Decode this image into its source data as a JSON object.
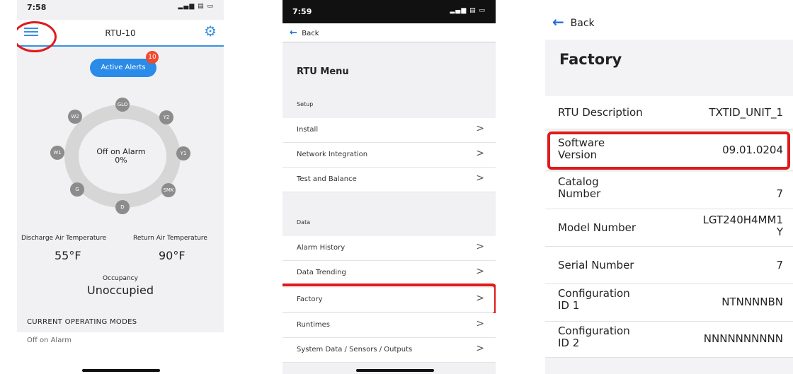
{
  "screen1": {
    "time": "7:58",
    "signal": "▂▄▆ ▤ ▭",
    "title": "RTU-10",
    "icons": {
      "menu": "menu-icon",
      "settings": "gear-icon"
    },
    "active_alerts_label": "Active Alerts",
    "alert_count": "10",
    "ring_nodes": {
      "glo": "GLO",
      "y2": "Y2",
      "y1": "Y1",
      "smk": "SMK",
      "d": "D",
      "g": "G",
      "w1": "W1",
      "w2": "W2"
    },
    "center_status": "Off on Alarm",
    "center_percent": "0%",
    "discharge_label": "Discharge Air Temperature",
    "discharge_value": "55°F",
    "return_label": "Return Air Temperature",
    "return_value": "90°F",
    "occupancy_label": "Occupancy",
    "occupancy_value": "Unoccupied",
    "modes_heading": "CURRENT OPERATING MODES",
    "modes_first": "Off on Alarm"
  },
  "screen2": {
    "time": "7:59",
    "signal": "▂▄▆ ▤ ▭",
    "back_label": "Back",
    "title": "RTU Menu",
    "setup_label": "Setup",
    "setup_items": [
      "Install",
      "Network Integration",
      "Test and Balance"
    ],
    "data_label": "Data",
    "data_items": [
      "Alarm History",
      "Data Trending",
      "Factory",
      "Runtimes",
      "System Data / Sensors / Outputs"
    ],
    "chevron": ">"
  },
  "screen3": {
    "back_label": "Back",
    "title": "Factory",
    "rows": [
      {
        "key": "RTU Description",
        "value": "TXTID_UNIT_1"
      },
      {
        "key": "Software\nVersion",
        "value": "09.01.0204"
      },
      {
        "key": "Catalog\nNumber",
        "value": "7"
      },
      {
        "key": "Model Number",
        "value": "LGT240H4MM1\nY"
      },
      {
        "key": "Serial Number",
        "value": "7"
      },
      {
        "key": "Configuration\nID 1",
        "value": "NTNNNNBN"
      },
      {
        "key": "Configuration\nID 2",
        "value": "NNNNNNNNNN"
      }
    ]
  },
  "colors": {
    "accent": "#3b8fe0",
    "highlight": "#e01a1a",
    "badge": "#f04a2f"
  }
}
